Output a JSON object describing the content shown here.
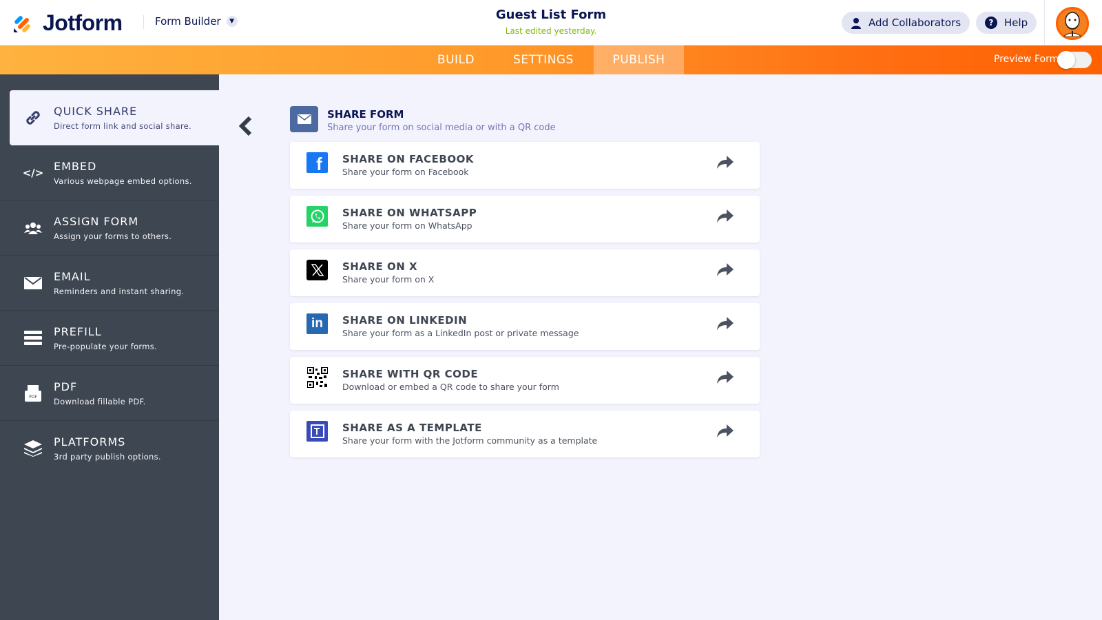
{
  "header": {
    "brand": "Jotform",
    "mode": "Form Builder",
    "form_title": "Guest List Form",
    "last_edited": "Last edited yesterday.",
    "add_collaborators": "Add Collaborators",
    "help": "Help"
  },
  "nav": {
    "tabs": [
      "BUILD",
      "SETTINGS",
      "PUBLISH"
    ],
    "active_tab": "PUBLISH",
    "preview_label": "Preview Form",
    "preview_on": false
  },
  "sidebar": {
    "items": [
      {
        "label": "QUICK SHARE",
        "desc": "Direct form link and social share."
      },
      {
        "label": "EMBED",
        "desc": "Various webpage embed options."
      },
      {
        "label": "ASSIGN FORM",
        "desc": "Assign your forms to others."
      },
      {
        "label": "EMAIL",
        "desc": "Reminders and instant sharing."
      },
      {
        "label": "PREFILL",
        "desc": "Pre-populate your forms."
      },
      {
        "label": "PDF",
        "desc": "Download fillable PDF."
      },
      {
        "label": "PLATFORMS",
        "desc": "3rd party publish options."
      }
    ]
  },
  "main": {
    "section_title": "SHARE FORM",
    "section_desc": "Share your form on social media or with a QR code",
    "options": [
      {
        "title": "SHARE ON FACEBOOK",
        "desc": "Share your form on Facebook",
        "icon": "facebook-icon",
        "color": "#1877f2"
      },
      {
        "title": "SHARE ON WHATSAPP",
        "desc": "Share your form on WhatsApp",
        "icon": "whatsapp-icon",
        "color": "#25d366"
      },
      {
        "title": "SHARE ON X",
        "desc": "Share your form on X",
        "icon": "x-icon",
        "color": "#000000"
      },
      {
        "title": "SHARE ON LINKEDIN",
        "desc": "Share your form as a LinkedIn post or private message",
        "icon": "linkedin-icon",
        "color": "#2867b2"
      },
      {
        "title": "SHARE WITH QR CODE",
        "desc": "Download or embed a QR code to share your form",
        "icon": "qr-code-icon",
        "color": "#000000"
      },
      {
        "title": "SHARE AS A TEMPLATE",
        "desc": "Share your form with the Jotform community as a template",
        "icon": "template-icon",
        "color": "#3a4ab8"
      }
    ]
  }
}
